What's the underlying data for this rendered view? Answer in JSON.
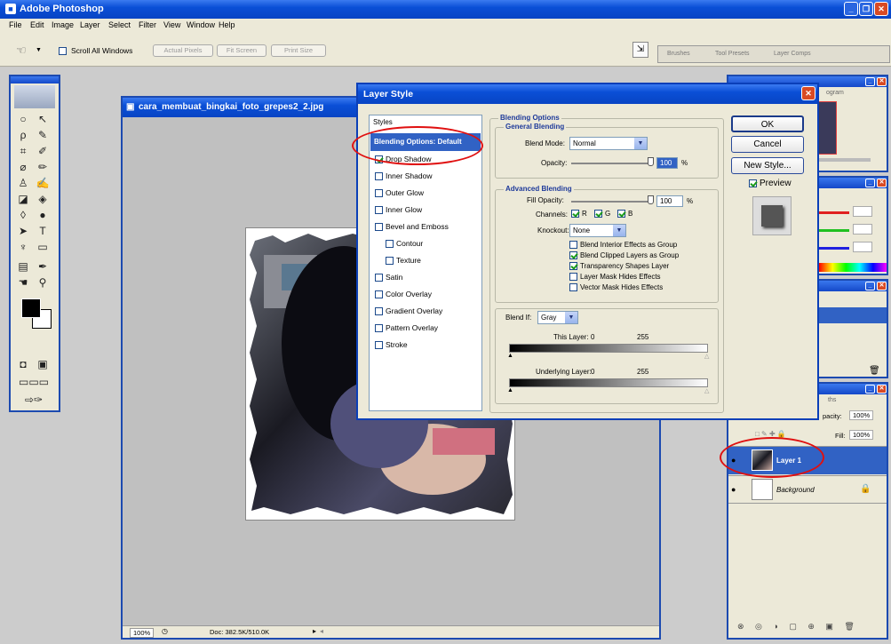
{
  "app": {
    "title": "Adobe Photoshop"
  },
  "menu": [
    "File",
    "Edit",
    "Image",
    "Layer",
    "Select",
    "Filter",
    "View",
    "Window",
    "Help"
  ],
  "options_bar": {
    "scroll_all": "Scroll All Windows",
    "actual_pixels": "Actual Pixels",
    "fit_screen": "Fit Screen",
    "print_size": "Print Size",
    "tabs": [
      "Brushes",
      "Tool Presets",
      "Layer Comps"
    ]
  },
  "document": {
    "title": "cara_membuat_bingkai_foto_grepes2_2.jpg",
    "zoom": "100%",
    "doc_info": "Doc: 382.5K/510.0K"
  },
  "dialog": {
    "title": "Layer Style",
    "styles_header": "Styles",
    "styles": [
      {
        "label": "Blending Options: Default",
        "checkbox": false,
        "selected": true,
        "indent": false
      },
      {
        "label": "Drop Shadow",
        "checkbox": true,
        "checked": true,
        "indent": false
      },
      {
        "label": "Inner Shadow",
        "checkbox": true,
        "checked": false,
        "indent": false
      },
      {
        "label": "Outer Glow",
        "checkbox": true,
        "checked": false,
        "indent": false
      },
      {
        "label": "Inner Glow",
        "checkbox": true,
        "checked": false,
        "indent": false
      },
      {
        "label": "Bevel and Emboss",
        "checkbox": true,
        "checked": false,
        "indent": false
      },
      {
        "label": "Contour",
        "checkbox": true,
        "checked": false,
        "indent": true
      },
      {
        "label": "Texture",
        "checkbox": true,
        "checked": false,
        "indent": true
      },
      {
        "label": "Satin",
        "checkbox": true,
        "checked": false,
        "indent": false
      },
      {
        "label": "Color Overlay",
        "checkbox": true,
        "checked": false,
        "indent": false
      },
      {
        "label": "Gradient Overlay",
        "checkbox": true,
        "checked": false,
        "indent": false
      },
      {
        "label": "Pattern Overlay",
        "checkbox": true,
        "checked": false,
        "indent": false
      },
      {
        "label": "Stroke",
        "checkbox": true,
        "checked": false,
        "indent": false
      }
    ],
    "blending_options": "Blending Options",
    "general_blending": "General Blending",
    "blend_mode_label": "Blend Mode:",
    "blend_mode": "Normal",
    "opacity_label": "Opacity:",
    "opacity": "100",
    "pct": "%",
    "advanced_blending": "Advanced Blending",
    "fill_opacity_label": "Fill Opacity:",
    "fill_opacity": "100",
    "channels_label": "Channels:",
    "channels": [
      "R",
      "G",
      "B"
    ],
    "knockout_label": "Knockout:",
    "knockout": "None",
    "adv_options": [
      {
        "label": "Blend Interior Effects as Group",
        "checked": false
      },
      {
        "label": "Blend Clipped Layers as Group",
        "checked": true
      },
      {
        "label": "Transparency Shapes Layer",
        "checked": true
      },
      {
        "label": "Layer Mask Hides Effects",
        "checked": false
      },
      {
        "label": "Vector Mask Hides Effects",
        "checked": false
      }
    ],
    "blend_if_label": "Blend If:",
    "blend_if": "Gray",
    "this_layer_label": "This Layer:",
    "this_layer_min": "0",
    "this_layer_max": "255",
    "underlying_label": "Underlying Layer:",
    "underlying_min": "0",
    "underlying_max": "255",
    "ok": "OK",
    "cancel": "Cancel",
    "new_style": "New Style...",
    "preview": "Preview"
  },
  "panels": {
    "navigator_tab": "ogram",
    "layers": {
      "tab": "ths",
      "opacity_label": "pacity:",
      "opacity": "100%",
      "fill_label": "Fill:",
      "fill": "100%",
      "items": [
        {
          "name": "Layer 1",
          "selected": true
        },
        {
          "name": "Background",
          "selected": false
        }
      ]
    }
  }
}
